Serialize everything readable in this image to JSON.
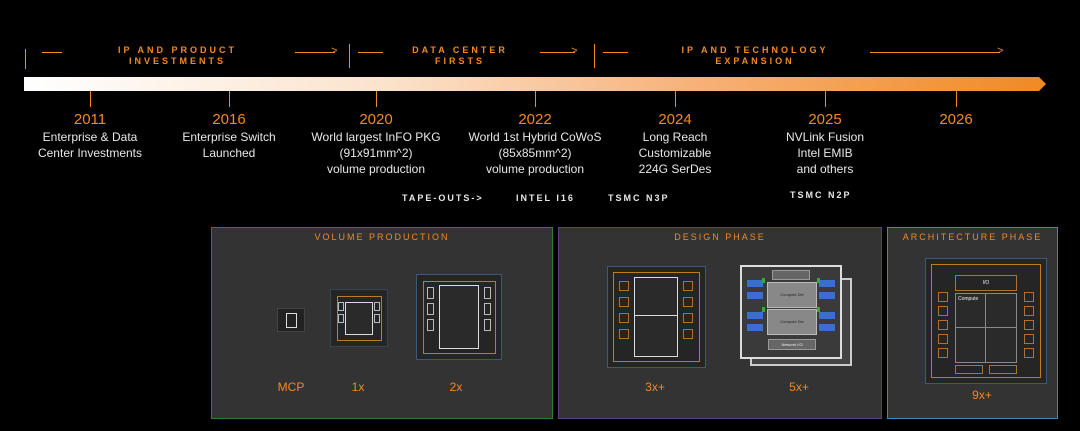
{
  "phases": [
    {
      "label": "IP AND PRODUCT\nINVESTMENTS"
    },
    {
      "label": "DATA CENTER\nFIRSTS"
    },
    {
      "label": "IP AND TECHNOLOGY\nEXPANSION"
    }
  ],
  "timeline": [
    {
      "year": "2011",
      "desc": "Enterprise & Data\nCenter Investments"
    },
    {
      "year": "2016",
      "desc": "Enterprise Switch\nLaunched"
    },
    {
      "year": "2020",
      "desc": "World largest InFO PKG\n(91x91mm^2)\nvolume production"
    },
    {
      "year": "2022",
      "desc": "World 1st Hybrid CoWoS\n(85x85mm^2)\nvolume production"
    },
    {
      "year": "2024",
      "desc": "Long Reach\nCustomizable\n224G SerDes"
    },
    {
      "year": "2025",
      "desc": "NVLink Fusion\nIntel EMIB\nand others"
    },
    {
      "year": "2026",
      "desc": ""
    }
  ],
  "tapeouts": {
    "label": "TAPE-OUTS->",
    "items": [
      "INTEL I16",
      "TSMC N3P",
      "TSMC N2P"
    ]
  },
  "panels": {
    "volume": {
      "title": "VOLUME PRODUCTION",
      "labels": [
        "MCP",
        "1x",
        "2x"
      ]
    },
    "design": {
      "title": "DESIGN PHASE",
      "labels": [
        "3x+",
        "5x+"
      ],
      "chip_text": [
        "Compute Die",
        "Compute Die",
        "Network I/O"
      ]
    },
    "architecture": {
      "title": "ARCHITECTURE PHASE",
      "labels": [
        "9x+"
      ],
      "chip_text": [
        "I/O",
        "Compute"
      ]
    }
  },
  "colors": {
    "accent": "#f08a24",
    "volume_border": "#2e7d3a",
    "design_border": "#5a3f8a",
    "arch_border": "#2f8fbf",
    "chip_blue": "#3a6fd0",
    "chip_green": "#37a83a"
  }
}
